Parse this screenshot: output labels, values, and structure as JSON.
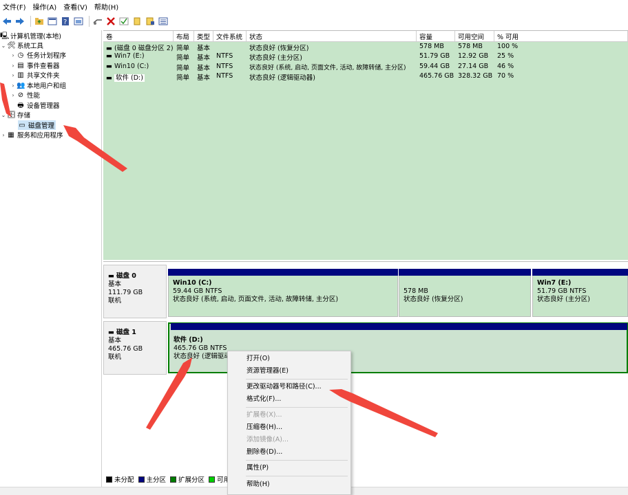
{
  "menu": [
    "文件(F)",
    "操作(A)",
    "查看(V)",
    "帮助(H)"
  ],
  "toolbar_icons": [
    "back-arrow-icon",
    "forward-arrow-icon",
    "folder-up-icon",
    "console-icon",
    "help-icon",
    "view-icon",
    "connect-icon",
    "delete-icon",
    "check-icon",
    "new-icon",
    "properties-icon",
    "list-icon"
  ],
  "tree": {
    "root": "计算机管理(本地)",
    "system_tools": "系统工具",
    "task_scheduler": "任务计划程序",
    "event_viewer": "事件查看器",
    "shared_folders": "共享文件夹",
    "local_users": "本地用户和组",
    "performance": "性能",
    "device_manager": "设备管理器",
    "storage": "存储",
    "disk_management": "磁盘管理",
    "services_apps": "服务和应用程序"
  },
  "volume_table": {
    "headers": [
      "卷",
      "布局",
      "类型",
      "文件系统",
      "状态",
      "容量",
      "可用空间",
      "% 可用"
    ],
    "rows": [
      [
        "(磁盘 0 磁盘分区 2)",
        "简单",
        "基本",
        "",
        "状态良好 (恢复分区)",
        "578 MB",
        "578 MB",
        "100 %"
      ],
      [
        "Win7 (E:)",
        "简单",
        "基本",
        "NTFS",
        "状态良好 (主分区)",
        "51.79 GB",
        "12.92 GB",
        "25 %"
      ],
      [
        "Win10 (C:)",
        "简单",
        "基本",
        "NTFS",
        "状态良好 (系统, 启动, 页面文件, 活动, 故障转储, 主分区)",
        "59.44 GB",
        "27.14 GB",
        "46 %"
      ],
      [
        "软件 (D:)",
        "简单",
        "基本",
        "NTFS",
        "状态良好 (逻辑驱动器)",
        "465.76 GB",
        "328.32 GB",
        "70 %"
      ]
    ]
  },
  "disks": {
    "disk0": {
      "name": "磁盘 0",
      "type": "基本",
      "size": "111.79 GB",
      "status": "联机",
      "p1_title": "Win10  (C:)",
      "p1_size": "59.44 GB NTFS",
      "p1_status": "状态良好 (系统, 启动, 页面文件, 活动, 故障转储, 主分区)",
      "p2_size": "578 MB",
      "p2_status": "状态良好 (恢复分区)",
      "p3_title": "Win7  (E:)",
      "p3_size": "51.79 GB NTFS",
      "p3_status": "状态良好 (主分区)"
    },
    "disk1": {
      "name": "磁盘 1",
      "type": "基本",
      "size": "465.76 GB",
      "status": "联机",
      "p1_title": "软件  (D:)",
      "p1_size": "465.76 GB NTFS",
      "p1_status": "状态良好 (逻辑驱动器)"
    }
  },
  "legend": {
    "unallocated": "未分配",
    "primary": "主分区",
    "extended": "扩展分区",
    "free": "可用",
    "colors": {
      "unallocated": "#000000",
      "primary": "#00067f",
      "extended": "#007d00",
      "free": "#00d000"
    }
  },
  "context_menu": {
    "open": "打开(O)",
    "explorer": "资源管理器(E)",
    "change_letter": "更改驱动器号和路径(C)...",
    "format": "格式化(F)...",
    "extend": "扩展卷(X)...",
    "shrink": "压缩卷(H)...",
    "add_mirror": "添加镜像(A)...",
    "delete": "删除卷(D)...",
    "properties": "属性(P)",
    "help": "帮助(H)"
  },
  "colors": {
    "volume_bg": "#c7e5c9",
    "primary_bar": "#00067f",
    "arrow": "#f0463c"
  }
}
